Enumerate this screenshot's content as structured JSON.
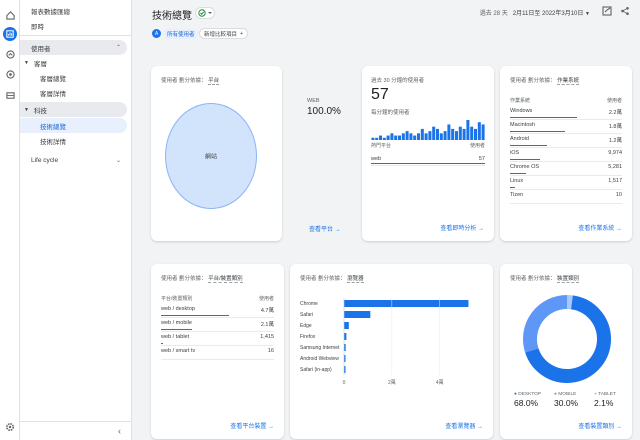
{
  "nav": {
    "report_snapshot": "報表數據匯總",
    "realtime": "即時",
    "users_label": "使用者",
    "overview_group": "客層",
    "overview_items": [
      "客層總覽",
      "客層詳情"
    ],
    "tech_group": "科技",
    "tech_items": [
      "技術總覽",
      "技術詳情"
    ],
    "lifecycle": "Life cycle"
  },
  "header": {
    "title": "技術總覽",
    "range_label": "過去 28 天",
    "range_dates": "2月11日至 2022年3月10日",
    "all_users": "所有使用者",
    "add_comparison": "新增比較項目"
  },
  "platform_card": {
    "head_prefix": "使用者",
    "head_dim_label": "劃分依據：",
    "head_dim": "平台",
    "slice_label": "網站",
    "legend_name": "WEB",
    "legend_value": "100.0%",
    "pie_value": 100,
    "link": "查看平台"
  },
  "realtime_card": {
    "title": "過去 30 分鐘的使用者",
    "value": "57",
    "subtitle": "每分鐘的使用者",
    "bars": [
      1,
      1,
      2,
      1,
      2,
      3,
      2,
      2,
      3,
      4,
      3,
      2,
      3,
      5,
      3,
      4,
      6,
      5,
      3,
      4,
      7,
      5,
      4,
      6,
      5,
      9,
      6,
      5,
      8,
      7
    ],
    "table_head": "熱門平台",
    "table_head_right": "使用者",
    "row_label": "web",
    "row_value": "57",
    "link": "查看即時分析"
  },
  "os_card": {
    "head_prefix": "使用者",
    "head_dim_label": "劃分依據：",
    "head_dim": "作業系統",
    "col1": "作業系統",
    "col2": "使用者",
    "rows": [
      {
        "label": "Windows",
        "value": "2.2萬",
        "share": 1.0
      },
      {
        "label": "Macintosh",
        "value": "1.8萬",
        "share": 0.82
      },
      {
        "label": "Android",
        "value": "1.2萬",
        "share": 0.55
      },
      {
        "label": "iOS",
        "value": "9,974",
        "share": 0.45
      },
      {
        "label": "Chrome OS",
        "value": "5,281",
        "share": 0.24
      },
      {
        "label": "Linux",
        "value": "1,517",
        "share": 0.07
      },
      {
        "label": "Tizen",
        "value": "10",
        "share": 0.0
      }
    ],
    "link": "查看作業系統"
  },
  "device_card": {
    "head_prefix": "使用者",
    "head_dim_label": "劃分依據：",
    "head_dim": "平台/裝置類別",
    "col1": "平台/裝置類別",
    "col2": "使用者",
    "rows": [
      {
        "label": "web / desktop",
        "value": "4.7萬",
        "share": 1.0
      },
      {
        "label": "web / mobile",
        "value": "2.1萬",
        "share": 0.45
      },
      {
        "label": "web / tablet",
        "value": "1,415",
        "share": 0.03
      },
      {
        "label": "web / smart tv",
        "value": "16",
        "share": 0.0
      }
    ],
    "link": "查看平台裝置"
  },
  "browser_card": {
    "head_prefix": "使用者",
    "head_dim_label": "劃分依據：",
    "head_dim": "瀏覽器",
    "link": "查看瀏覽器"
  },
  "category_card": {
    "head_prefix": "使用者",
    "head_dim_label": "劃分依據：",
    "head_dim": "裝置類別",
    "legend": [
      {
        "name": "DESKTOP",
        "value": "68.0%",
        "color": "#1a73e8"
      },
      {
        "name": "MOBILE",
        "value": "30.0%",
        "color": "#5e97f6"
      },
      {
        "name": "TABLET",
        "value": "2.1%",
        "color": "#a8c7fa"
      }
    ],
    "link": "查看裝置類別"
  },
  "chart_data": [
    {
      "type": "bar",
      "orientation": "horizontal",
      "categories": [
        "Chrome",
        "Safari",
        "Edge",
        "Firefox",
        "Samsung Internet",
        "Android Webview",
        "Safari (in-app)"
      ],
      "values": [
        52000,
        11000,
        2000,
        1000,
        700,
        400,
        200
      ],
      "tick_labels": [
        "0",
        "2萬",
        "4萬"
      ],
      "xlim": [
        0,
        56000
      ]
    },
    {
      "type": "pie",
      "donut": true,
      "categories": [
        "DESKTOP",
        "MOBILE",
        "TABLET"
      ],
      "values": [
        68.0,
        30.0,
        2.1
      ]
    }
  ],
  "colors": {
    "accent": "#1a73e8",
    "light_blue": "#d2e3fc",
    "text": "#3c4043"
  }
}
